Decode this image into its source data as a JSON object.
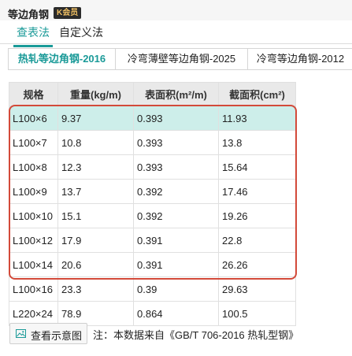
{
  "app": {
    "title": "等边角钢",
    "vip_badge": "K会员"
  },
  "mode_tabs": [
    "查表法",
    "自定义法"
  ],
  "standard_tabs": [
    "热轧等边角钢-2016",
    "冷弯薄壁等边角钢-2025",
    "冷弯等边角钢-2012"
  ],
  "table": {
    "headers": [
      "规格",
      "重量(kg/m)",
      "表面积(m²/m)",
      "截面积(cm²)"
    ],
    "rows": [
      [
        "L100×6",
        "9.37",
        "0.393",
        "11.93"
      ],
      [
        "L100×7",
        "10.8",
        "0.393",
        "13.8"
      ],
      [
        "L100×8",
        "12.3",
        "0.393",
        "15.64"
      ],
      [
        "L100×9",
        "13.7",
        "0.392",
        "17.46"
      ],
      [
        "L100×10",
        "15.1",
        "0.392",
        "19.26"
      ],
      [
        "L100×12",
        "17.9",
        "0.391",
        "22.8"
      ],
      [
        "L100×14",
        "20.6",
        "0.391",
        "26.26"
      ],
      [
        "L100×16",
        "23.3",
        "0.39",
        "29.63"
      ],
      [
        "L220×24",
        "78.9",
        "0.864",
        "100.5"
      ]
    ]
  },
  "footer": {
    "schematic_button": "查看示意图",
    "schematic_icon": "image-icon",
    "note": "注：本数据来自《GB/T 706-2016 热轧型钢》"
  },
  "colors": {
    "accent": "#1a9a98",
    "selected_row": "#cdeeea",
    "highlight_border": "#d34a3a"
  }
}
